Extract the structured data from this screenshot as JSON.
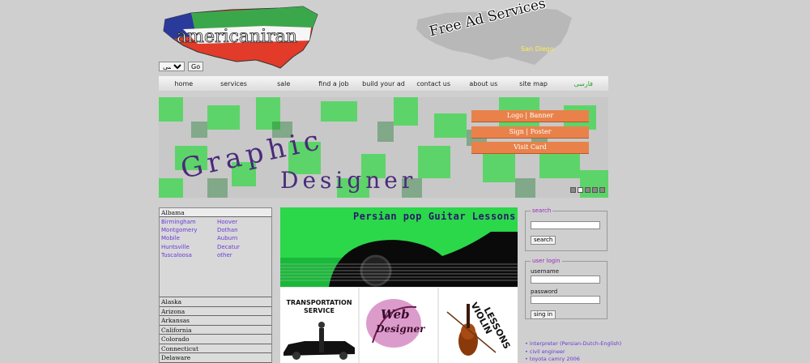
{
  "header": {
    "logo_text": "americaniran",
    "free_ad": "Free Ad Services",
    "city": "San Diego",
    "lang_select_value": "فارسی",
    "go_label": "Go"
  },
  "nav": {
    "items": [
      "home",
      "services",
      "sale",
      "find a job",
      "build your ad",
      "contact us",
      "about us",
      "site map",
      "فارسی"
    ]
  },
  "banner": {
    "line1": "Graphic",
    "line2": "Designer",
    "buttons": [
      "Logo | Banner",
      "Sign | Poster",
      "Visit Card"
    ],
    "dots_active_index": 1,
    "colors": {
      "accent": "#e8824a",
      "green": "#3ad84a"
    }
  },
  "states": {
    "open": {
      "name": "Albama",
      "cities": [
        "Birmingham",
        "Hoover",
        "Montgomery",
        "Dothan",
        "Mobile",
        "Auburn",
        "Huntsville",
        "Decatur",
        "Tuscaloosa",
        "other"
      ]
    },
    "others": [
      "Alaska",
      "Arizona",
      "Arkansas",
      "California",
      "Colorado",
      "Connecticut",
      "Delaware"
    ]
  },
  "gallery": {
    "guitar_title": "Persian pop Guitar Lessons",
    "tile1": "TRANSPORTATION SERVICE",
    "tile2_a": "Web",
    "tile2_b": "Designer",
    "tile3_a": "VIOLIN",
    "tile3_b": "LESSONS"
  },
  "search": {
    "legend": "search",
    "button": "search"
  },
  "login": {
    "legend": "user login",
    "username_label": "username",
    "password_label": "password",
    "button": "sing in"
  },
  "ads": [
    "• interpreter (Persian-Dutch-English)",
    "• civil engineer",
    "• toyota camry 2006"
  ]
}
